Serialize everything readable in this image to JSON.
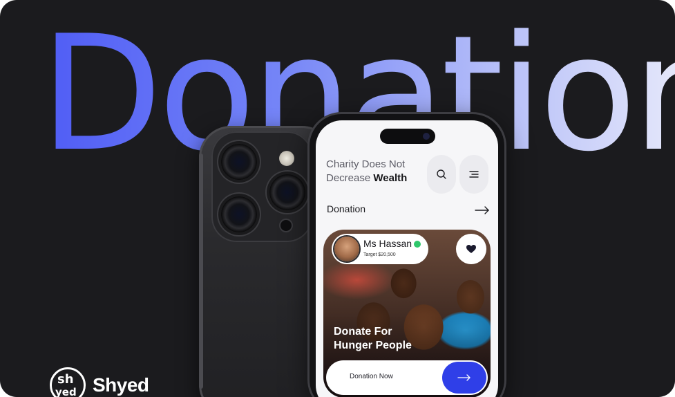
{
  "hero": {
    "title": "Donation"
  },
  "app": {
    "headline_line1": "Charity Does Not",
    "headline_line2_prefix": "Decrease ",
    "headline_line2_accent": "Wealth",
    "search_icon": "search-icon",
    "menu_icon": "menu-icon",
    "section_title": "Donation",
    "card": {
      "name": "Ms Hassan",
      "target": "Target $20,500",
      "title_line1": "Donate For",
      "title_line2": "Hunger People",
      "cta_label": "Donation Now"
    }
  },
  "brand": {
    "logo_top": "sh",
    "logo_bottom": "yed",
    "name": "Shyed"
  },
  "colors": {
    "accent": "#2f3fe8",
    "verified": "#2fc76b",
    "background": "#1b1b1e"
  }
}
